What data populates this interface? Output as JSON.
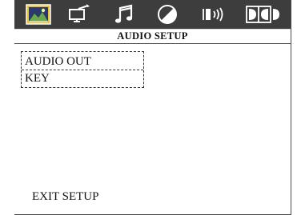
{
  "toolbar": {
    "tabs": [
      {
        "icon": "language-icon",
        "selected": true
      },
      {
        "icon": "video-setup-icon",
        "selected": false
      },
      {
        "icon": "music-note-icon",
        "selected": false
      },
      {
        "icon": "contrast-icon",
        "selected": false
      },
      {
        "icon": "speaker-icon",
        "selected": false
      },
      {
        "icon": "dolby-icon",
        "selected": false
      }
    ]
  },
  "page": {
    "title": "AUDIO SETUP"
  },
  "menu": {
    "items": [
      {
        "label": "AUDIO OUT"
      },
      {
        "label": "KEY"
      }
    ]
  },
  "footer": {
    "exit_label": "EXIT SETUP"
  },
  "colors": {
    "toolbar_bg": "#3d3d3d",
    "icon_color": "#ffffff",
    "selected_tab_bg": "#f2d34a"
  }
}
